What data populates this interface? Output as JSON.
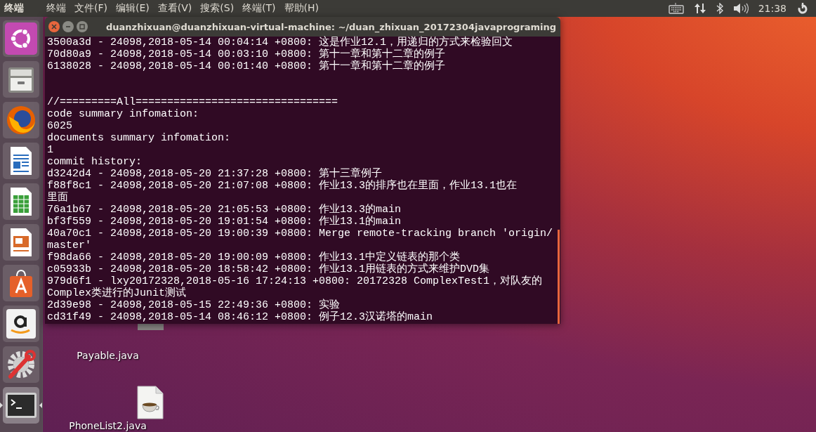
{
  "top_bar": {
    "app_name": "终端",
    "menu": [
      "终端",
      "文件(F)",
      "编辑(E)",
      "查看(V)",
      "搜索(S)",
      "终端(T)",
      "帮助(H)"
    ],
    "clock": "21:38"
  },
  "launcher": {
    "items": [
      {
        "kind": "ubuntu",
        "selected": false
      },
      {
        "kind": "files",
        "selected": false
      },
      {
        "kind": "firefox",
        "selected": false
      },
      {
        "kind": "writer",
        "selected": false
      },
      {
        "kind": "calc",
        "selected": false
      },
      {
        "kind": "impress",
        "selected": false
      },
      {
        "kind": "software",
        "selected": false
      },
      {
        "kind": "amazon",
        "selected": false
      },
      {
        "kind": "settings",
        "selected": false
      },
      {
        "kind": "terminal",
        "selected": true
      }
    ]
  },
  "desktop_icons": [
    {
      "label": "Payable.java",
      "kind": "java"
    },
    {
      "label": "PhoneList2.java",
      "kind": "java"
    }
  ],
  "terminal": {
    "title": "duanzhixuan@duanzhixuan-virtual-machine: ~/duan_zhixuan_20172304javaprograming",
    "lines": [
      {
        "kind": "text",
        "text": "3500a3d - 24098,2018-05-14 00:04:14 +0800: 这是作业12.1，用递归的方式来检验回文"
      },
      {
        "kind": "text",
        "text": "70d80a9 - 24098,2018-05-14 00:03:10 +0800: 第十一章和第十二章的例子"
      },
      {
        "kind": "text",
        "text": "6138028 - 24098,2018-05-14 00:01:40 +0800: 第十一章和第十二章的例子"
      },
      {
        "kind": "blank"
      },
      {
        "kind": "blank"
      },
      {
        "kind": "text",
        "text": "//=========All================================"
      },
      {
        "kind": "text",
        "text": "code summary infomation:"
      },
      {
        "kind": "text",
        "text": "6025"
      },
      {
        "kind": "text",
        "text": "documents summary infomation:"
      },
      {
        "kind": "text",
        "text": "1"
      },
      {
        "kind": "text",
        "text": "commit history:"
      },
      {
        "kind": "text",
        "text": "d3242d4 - 24098,2018-05-20 21:37:28 +0800: 第十三章例子"
      },
      {
        "kind": "text",
        "text": "f88f8c1 - 24098,2018-05-20 21:07:08 +0800: 作业13.3的排序也在里面，作业13.1也在"
      },
      {
        "kind": "text",
        "text": "里面"
      },
      {
        "kind": "text",
        "text": "76a1b67 - 24098,2018-05-20 21:05:53 +0800: 作业13.3的main"
      },
      {
        "kind": "text",
        "text": "bf3f559 - 24098,2018-05-20 19:01:54 +0800: 作业13.1的main"
      },
      {
        "kind": "text",
        "text": "40a70c1 - 24098,2018-05-20 19:00:39 +0800: Merge remote-tracking branch 'origin/"
      },
      {
        "kind": "text",
        "text": "master'"
      },
      {
        "kind": "text",
        "text": "f98da66 - 24098,2018-05-20 19:00:09 +0800: 作业13.1中定义链表的那个类"
      },
      {
        "kind": "text",
        "text": "c05933b - 24098,2018-05-20 18:58:42 +0800: 作业13.1用链表的方式来维护DVD集"
      },
      {
        "kind": "text",
        "text": "979d6f1 - lxy20172328,2018-05-16 17:24:13 +0800: 20172328 ComplexTest1，对队友的"
      },
      {
        "kind": "text",
        "text": "Complex类进行的Junit测试"
      },
      {
        "kind": "text",
        "text": "2d39e98 - 24098,2018-05-15 22:49:36 +0800: 实验"
      },
      {
        "kind": "text",
        "text": "cd31f49 - 24098,2018-05-14 08:46:12 +0800: 例子12.3汉诺塔的main"
      }
    ]
  }
}
